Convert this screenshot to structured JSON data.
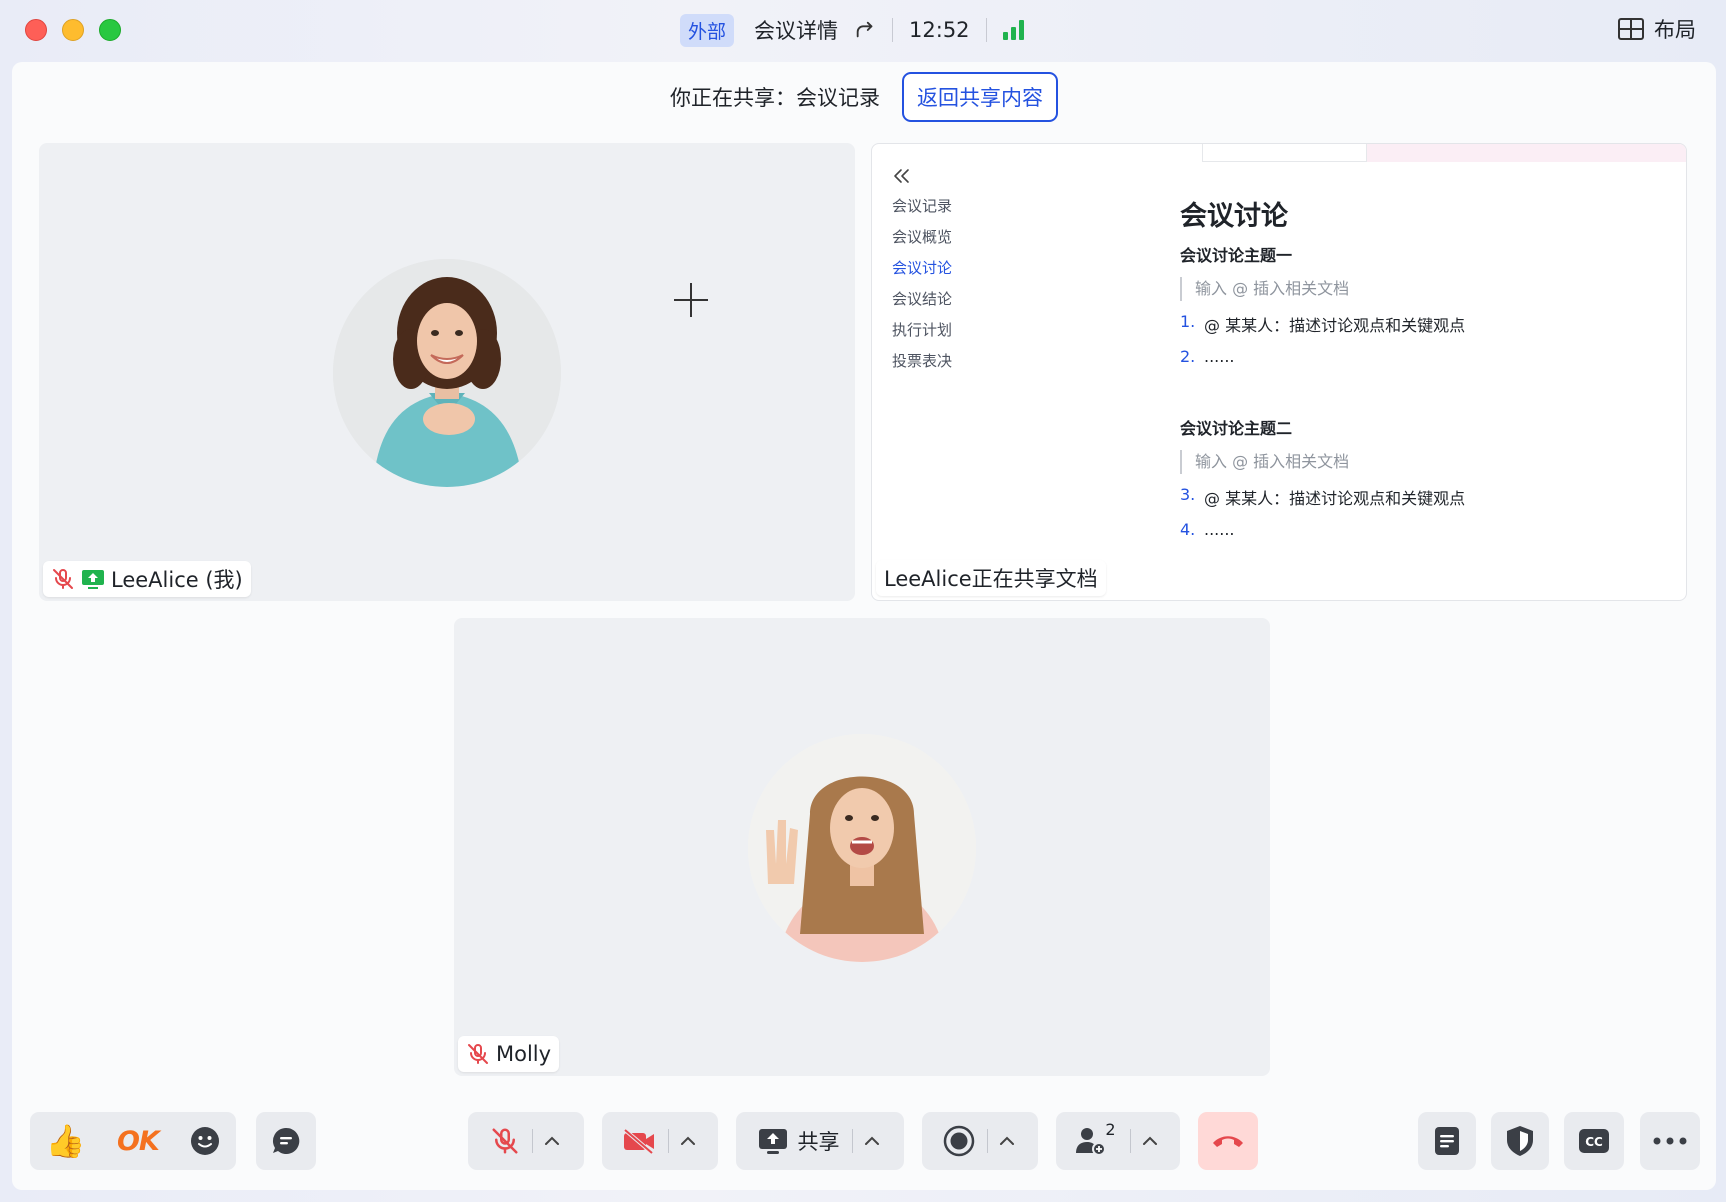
{
  "titlebar": {
    "badge": "外部",
    "meeting_details": "会议详情",
    "clock": "12:52",
    "layout_label": "布局"
  },
  "share_banner": {
    "text": "你正在共享：会议记录",
    "back_button": "返回共享内容"
  },
  "participants": [
    {
      "name": "LeeAlice (我)",
      "muted": true,
      "sharing": true
    },
    {
      "name": "Molly",
      "muted": true,
      "sharing": false
    }
  ],
  "shared_doc": {
    "tile_label": "LeeAlice正在共享文档",
    "outline": [
      "会议记录",
      "会议概览",
      "会议讨论",
      "会议结论",
      "执行计划",
      "投票表决"
    ],
    "active_outline": "会议讨论",
    "heading": "会议讨论",
    "sections": [
      {
        "title": "会议讨论主题一",
        "placeholder": "输入 @ 插入相关文档",
        "items": [
          {
            "num": "1.",
            "text": "@ 某某人：描述讨论观点和关键观点"
          },
          {
            "num": "2.",
            "text": "......"
          }
        ]
      },
      {
        "title": "会议讨论主题二",
        "placeholder": "输入 @ 插入相关文档",
        "items": [
          {
            "num": "3.",
            "text": "@ 某某人：描述讨论观点和关键观点"
          },
          {
            "num": "4.",
            "text": "......"
          }
        ]
      }
    ]
  },
  "toolbar": {
    "ok_label": "OK",
    "share_label": "共享",
    "participant_count": "2"
  },
  "colors": {
    "accent": "#2452e0",
    "danger": "#fe5f57",
    "signal": "#20b34e",
    "share_green": "#20b34e",
    "mute_red": "#e5484d"
  }
}
